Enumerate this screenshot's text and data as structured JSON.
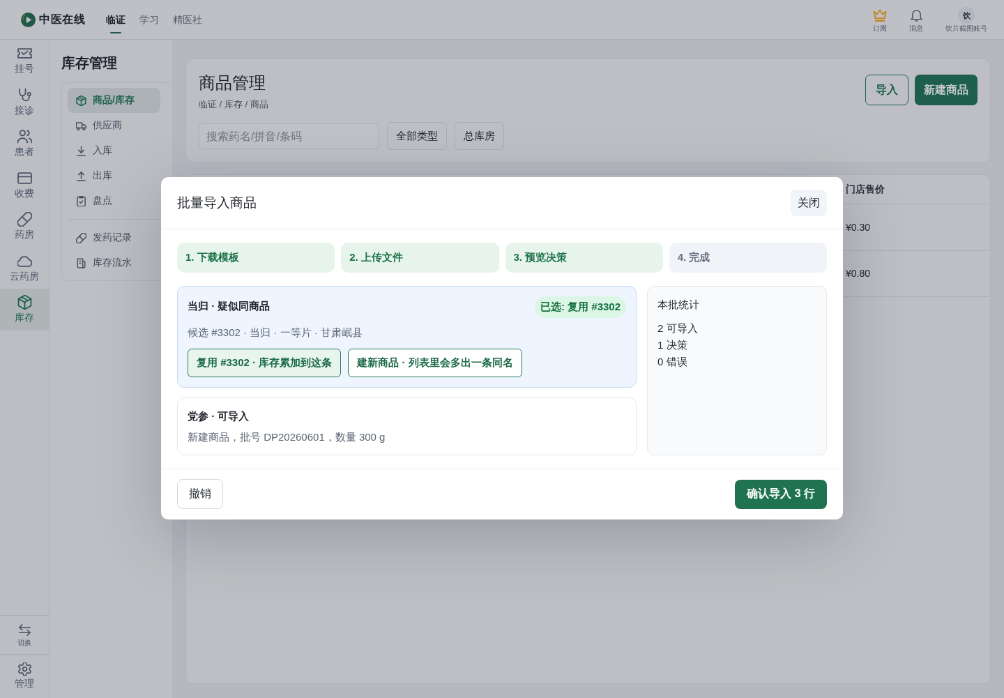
{
  "top_bar": {
    "logo_text": "中医在线",
    "tabs": [
      {
        "label": "临证",
        "selected": true
      },
      {
        "label": "学习",
        "selected": false
      },
      {
        "label": "精医社",
        "selected": false
      }
    ],
    "actions": [
      {
        "label": "订阅"
      },
      {
        "label": "消息"
      }
    ],
    "account": {
      "avatar_text": "饮",
      "name": "饮片截图账号"
    }
  },
  "rail": {
    "items": [
      {
        "label": "挂号",
        "selected": false
      },
      {
        "label": "接诊",
        "selected": false
      },
      {
        "label": "患者",
        "selected": false
      },
      {
        "label": "收费",
        "selected": false
      },
      {
        "label": "药房",
        "selected": false
      },
      {
        "label": "云药房",
        "selected": false
      },
      {
        "label": "库存",
        "selected": true
      }
    ],
    "switch_label": "切换",
    "manage_label": "管理"
  },
  "sidebar": {
    "title": "库存管理",
    "groups": [
      {
        "items": [
          {
            "label": "商品/库存",
            "selected": true
          },
          {
            "label": "供应商",
            "selected": false
          },
          {
            "label": "入库",
            "selected": false
          },
          {
            "label": "出库",
            "selected": false
          },
          {
            "label": "盘点",
            "selected": false
          }
        ]
      },
      {
        "items": [
          {
            "label": "发药记录",
            "selected": false
          },
          {
            "label": "库存流水",
            "selected": false
          }
        ]
      }
    ]
  },
  "page": {
    "title": "商品管理",
    "breadcrumb": "临证 / 库存 / 商品",
    "import_button": "导入",
    "new_button": "新建商品",
    "search": {
      "placeholder": "搜索药名/拼音/条码"
    },
    "filters": [
      "全部类型",
      "总库房"
    ]
  },
  "table": {
    "columns": [
      "门店售价"
    ],
    "rows": [
      [
        "¥0.30"
      ],
      [
        "¥0.80"
      ]
    ]
  },
  "dialog": {
    "title": "批量导入商品",
    "close": "关闭",
    "steps": [
      {
        "label": "1. 下载模板",
        "done": true
      },
      {
        "label": "2. 上传文件",
        "done": true
      },
      {
        "label": "3. 预览决策",
        "done": true
      },
      {
        "label": "4. 完成",
        "done": false
      }
    ],
    "items": [
      {
        "kind": "decision",
        "title": "当归 · 疑似同商品",
        "badge": "已选: 复用 #3302",
        "detail": "候选 #3302 · 当归 · 一等片 · 甘肃岷县",
        "options": [
          {
            "label": "复用 #3302 · 库存累加到这条",
            "selected": true
          },
          {
            "label": "建新商品 · 列表里会多出一条同名",
            "selected": false
          }
        ]
      },
      {
        "kind": "ready",
        "title": "党参 · 可导入",
        "detail": "新建商品，批号 DP20260601，数量 300 g"
      }
    ],
    "summary": {
      "title": "本批统计",
      "lines": [
        "2 可导入",
        "1 决策",
        "0 错误"
      ]
    },
    "cancel": "撤销",
    "confirm": "确认导入 3 行"
  }
}
